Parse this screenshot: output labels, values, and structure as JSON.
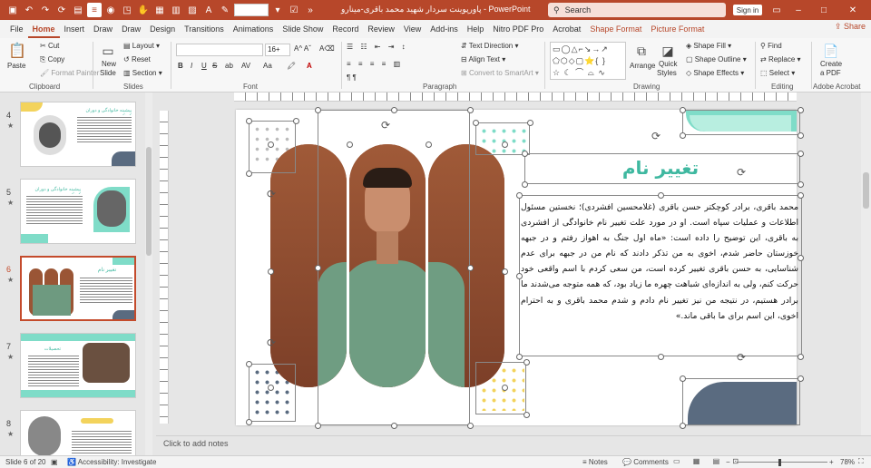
{
  "titlebar": {
    "doc_title": "پاورپوینت سردار شهید محمد باقری-مینارو  -  PowerPoint",
    "search_placeholder": "Search",
    "signin_label": "Sign in",
    "font_size_value": ""
  },
  "tabs": [
    "File",
    "Home",
    "Insert",
    "Draw",
    "Draw",
    "Design",
    "Transitions",
    "Animations",
    "Slide Show",
    "Record",
    "Review",
    "View",
    "Add-ins",
    "Help",
    "Nitro PDF Pro",
    "Acrobat",
    "Shape Format",
    "Picture Format"
  ],
  "share_label": "Share",
  "ribbon": {
    "clipboard": {
      "paste": "Paste",
      "cut": "Cut",
      "copy": "Copy",
      "format_painter": "Format Painter",
      "label": "Clipboard"
    },
    "slides": {
      "new_slide": "New",
      "slide": "Slide",
      "layout": "Layout",
      "reset": "Reset",
      "section": "Section",
      "label": "Slides"
    },
    "font": {
      "size": "16+",
      "label": "Font",
      "bold": "B",
      "italic": "I",
      "underline": "U",
      "strike": "S",
      "shadow": "ab",
      "spacing": "AV",
      "case": "Aa",
      "font_color": "A"
    },
    "paragraph": {
      "text_direction": "Text Direction",
      "align_text": "Align Text",
      "smartart": "Convert to SmartArt",
      "label": "Paragraph"
    },
    "drawing": {
      "arrange": "Arrange",
      "quick": "Quick",
      "styles": "Styles",
      "shape_fill": "Shape Fill",
      "shape_outline": "Shape Outline",
      "shape_effects": "Shape Effects",
      "label": "Drawing"
    },
    "editing": {
      "find": "Find",
      "replace": "Replace",
      "select": "Select",
      "label": "Editing"
    },
    "acrobat": {
      "create": "Create",
      "pdf": "a PDF",
      "label": "Adobe Acrobat"
    }
  },
  "thumbnails": [
    {
      "num": "4",
      "title": "پیشینه خانوادگی و دوران کودکی",
      "active": false
    },
    {
      "num": "5",
      "title": "پیشینه خانوادگی و دوران کودکی",
      "active": false
    },
    {
      "num": "6",
      "title": "تغییر نام",
      "active": true
    },
    {
      "num": "7",
      "title": "تحصیلات",
      "active": false
    },
    {
      "num": "8",
      "title": "",
      "active": false
    }
  ],
  "slide": {
    "title": "تغییر نام",
    "body": "محمد باقری، برادر کوچکتر حسن باقری (غلامحسین افشردی)؛ نخستین مسئول اطلاعات و عملیات سپاه است. او در مورد علت تغییر نام خانوادگی از افشردی به باقری، این توضیح را داده است: «ماه اول جنگ به اهواز رفتم و در جبهه خوزستان حاضر شدم، اخوی به من تذکر دادند که نام من در جبهه برای عدم شناسایی، به حسن باقری تغییر کرده است، من سعی کردم با اسم واقعی خود حرکت کنم، ولی به اندازه‌ای شباهت چهره ما زیاد بود، که همه متوجه می‌شدند ما برادر هستیم، در نتیجه من نیز تغییر نام دادم و شدم محمد باقری و به احترام اخوی، این اسم برای ما باقی ماند.»",
    "colors": {
      "accent": "#3fb8a0",
      "mint": "#7fdcc8",
      "slate": "#5a6b80",
      "yellow": "#f3d35c",
      "photo_bg": "#9a5535"
    }
  },
  "notes_placeholder": "Click to add notes",
  "status": {
    "slide_of": "Slide 6 of 20",
    "accessibility": "Accessibility: Investigate",
    "notes": "Notes",
    "comments": "Comments",
    "zoom": "78%"
  }
}
